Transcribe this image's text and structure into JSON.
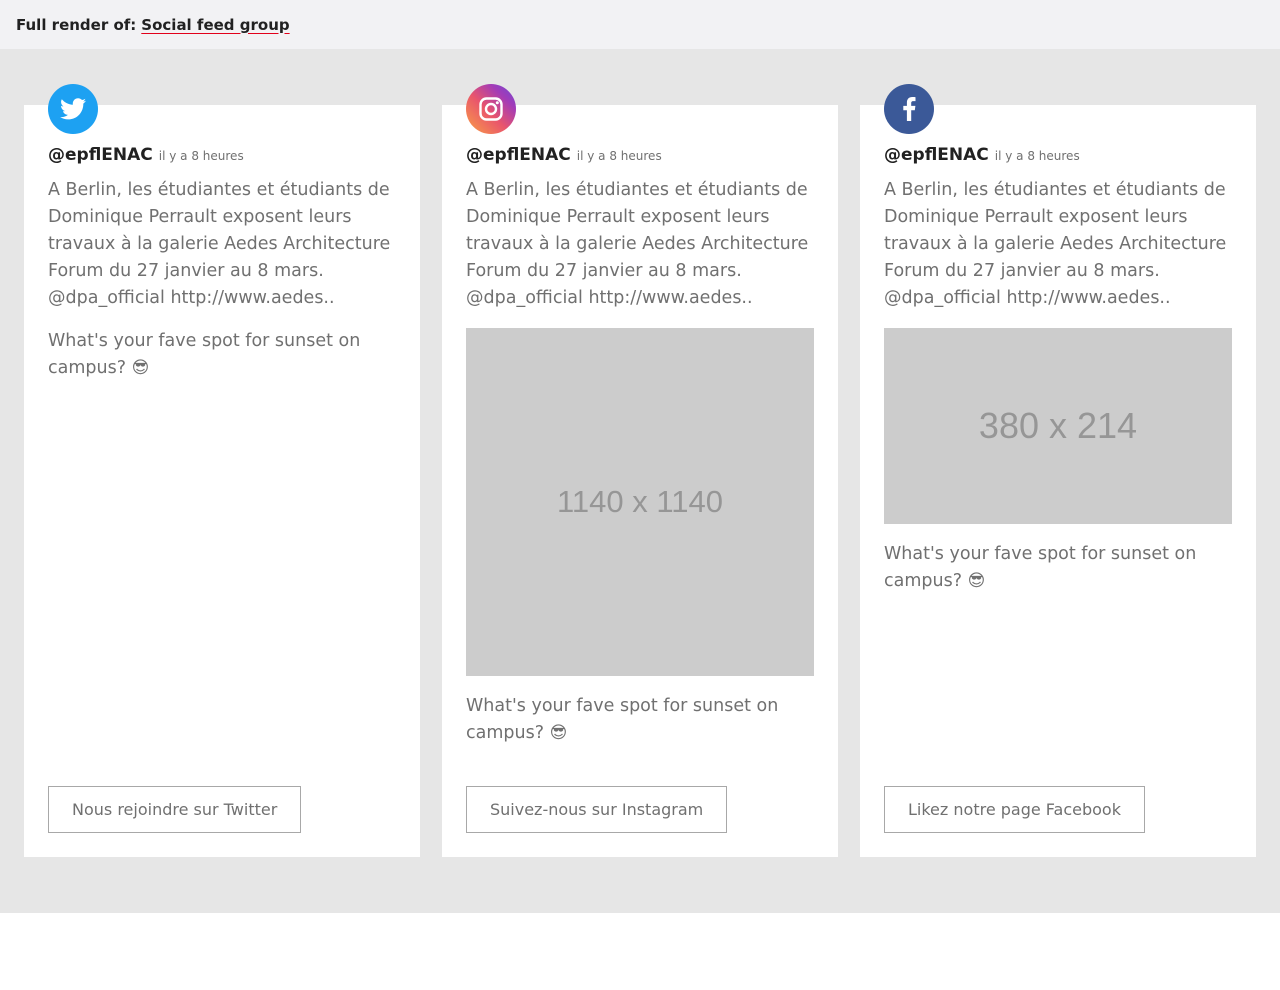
{
  "topbar": {
    "prefix": "Full render of:",
    "link": "Social feed group"
  },
  "colors": {
    "twitter": "#1da1f2",
    "facebook": "#3b5998",
    "stage_background": "#e6e6e6",
    "link_underline": "#e2001a"
  },
  "cards": [
    {
      "network": "twitter",
      "icon": "twitter-bird-icon",
      "handle": "@epflENAC",
      "time": "il y a 8 heures",
      "text1": "A Berlin, les étudiantes et étudiants de Dominique Perrault exposent leurs travaux à la galerie Aedes Architecture Forum du 27 janvier au 8 mars. @dpa_official http://www.aedes..",
      "text2": "What's your fave spot for sunset on campus?",
      "emoji": "😎",
      "cta": "Nous rejoindre sur Twitter"
    },
    {
      "network": "instagram",
      "icon": "instagram-camera-icon",
      "handle": "@epflENAC",
      "time": "il y a 8 heures",
      "text1": "A Berlin, les étudiantes et étudiants de Dominique Perrault exposent leurs travaux à la galerie Aedes Architecture Forum du 27 janvier au 8 mars. @dpa_official http://www.aedes..",
      "image_label": "1140 x 1140",
      "text2": "What's your fave spot for sunset on campus?",
      "emoji": "😎",
      "cta": "Suivez-nous sur Instagram"
    },
    {
      "network": "facebook",
      "icon": "facebook-f-icon",
      "handle": "@epflENAC",
      "time": "il y a 8 heures",
      "text1": "A Berlin, les étudiantes et étudiants de Dominique Perrault exposent leurs travaux à la galerie Aedes Architecture Forum du 27 janvier au 8 mars. @dpa_official http://www.aedes..",
      "image_label": "380 x 214",
      "text2": "What's your fave spot for sunset on campus?",
      "emoji": "😎",
      "cta": "Likez notre page Facebook"
    }
  ]
}
